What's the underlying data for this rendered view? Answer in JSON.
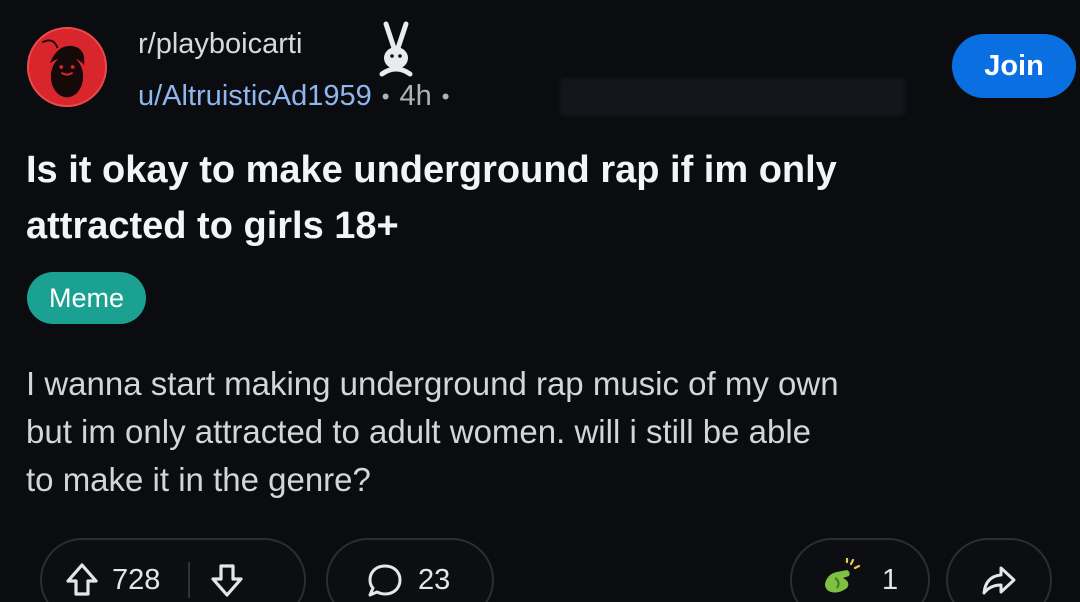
{
  "header": {
    "subreddit": "r/playboicarti",
    "username": "u/AltruisticAd1959",
    "separator": "•",
    "age": "4h",
    "join_label": "Join"
  },
  "post": {
    "title_lines": [
      "Is it okay to make underground rap if im only",
      "attracted to girls 18+"
    ],
    "flair": "Meme",
    "body_lines": [
      "I wanna start making underground rap music of my own",
      "but im only attracted to adult women. will i still be able",
      "to make it in the genre?"
    ]
  },
  "actions": {
    "upvotes": "728",
    "comments": "23",
    "awards": "1"
  },
  "colors": {
    "background": "#0b0c0f",
    "join_button": "#0a6fe0",
    "flair": "#1aa191",
    "username": "#8fb7ef"
  },
  "icons": [
    "subreddit-avatar",
    "bunny-icon",
    "upvote-icon",
    "downvote-icon",
    "comment-icon",
    "award-icon",
    "share-icon"
  ]
}
